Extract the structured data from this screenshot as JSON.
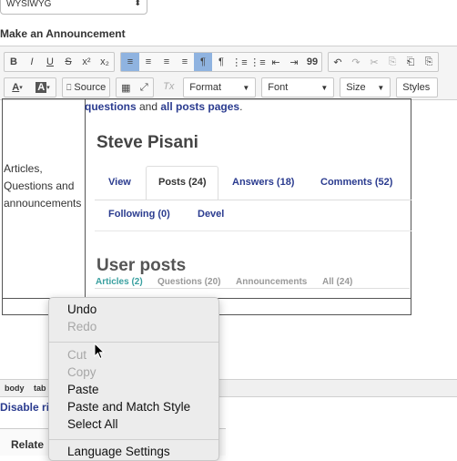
{
  "format_select": {
    "value": "WYSIWYG"
  },
  "section_title": "Make an Announcement",
  "toolbar": {
    "row1": {
      "group1": [
        "B",
        "I",
        "U",
        "S",
        "x²",
        "x₂"
      ],
      "group2": [
        "≡",
        "≡",
        "≡",
        "≡",
        "¶",
        "¶",
        "⋮≡",
        "⋮≡",
        "⇤",
        "⇥",
        "99"
      ],
      "group3": [
        "↶",
        "↷",
        "✂",
        "⎘",
        "⎗",
        "⎘"
      ]
    },
    "row2": {
      "source_label": "Source",
      "combos": [
        {
          "label": "Format"
        },
        {
          "label": "Font"
        },
        {
          "label": "Size"
        },
        {
          "label": "Styles"
        }
      ],
      "clear_format": "Tx"
    }
  },
  "editor": {
    "left_cell": [
      "Articles,",
      "Questions and",
      "announcements"
    ],
    "top_text": {
      "link1": "questions",
      "and": " and ",
      "link2": "all posts pages",
      "end": "."
    },
    "user_name": "Steve Pisani",
    "tabs": [
      "View",
      "Posts (24)",
      "Answers (18)",
      "Comments (52)",
      "Following (0)",
      "Devel"
    ],
    "posts_title": "User posts",
    "subtabs": [
      "Articles (2)",
      "Questions (20)",
      "Announcements",
      "All (24)"
    ]
  },
  "status_path": [
    "body",
    "tab"
  ],
  "disable_link": "Disable ric",
  "related_title": "Relate",
  "context_menu": {
    "items": [
      {
        "label": "Undo",
        "enabled": true
      },
      {
        "label": "Redo",
        "enabled": false
      },
      {
        "label": "Cut",
        "enabled": false
      },
      {
        "label": "Copy",
        "enabled": false
      },
      {
        "label": "Paste",
        "enabled": true
      },
      {
        "label": "Paste and Match Style",
        "enabled": true
      },
      {
        "label": "Select All",
        "enabled": true
      },
      {
        "label": "Language Settings",
        "enabled": true
      }
    ]
  }
}
